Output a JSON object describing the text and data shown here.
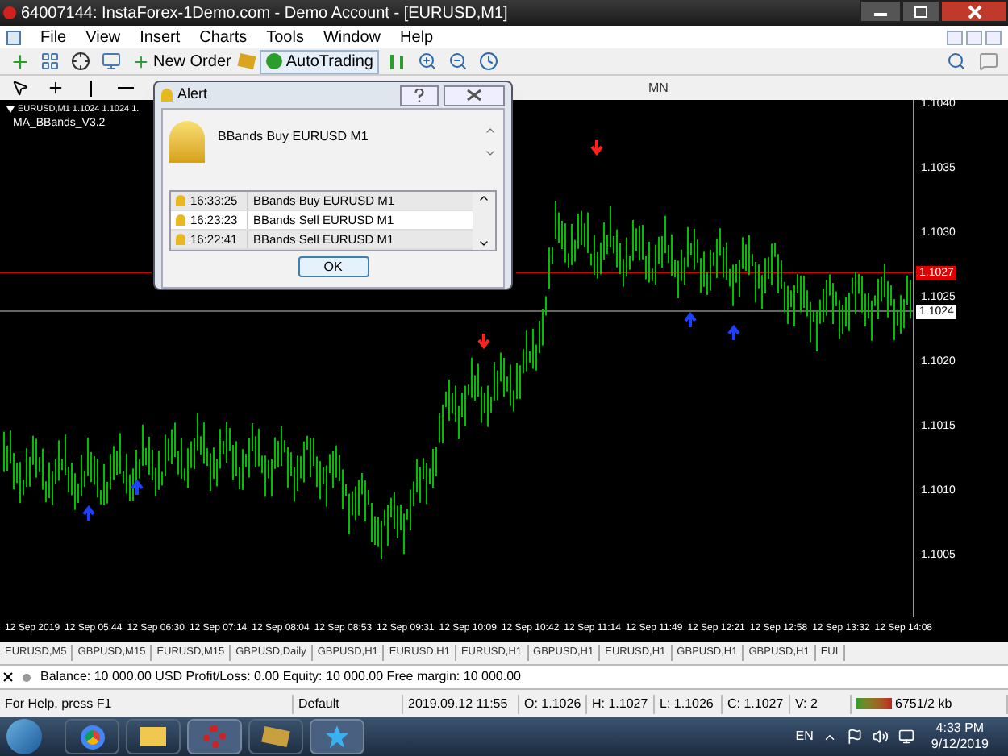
{
  "window": {
    "title": "64007144: InstaForex-1Demo.com - Demo Account - [EURUSD,M1]"
  },
  "menu": [
    "File",
    "View",
    "Insert",
    "Charts",
    "Tools",
    "Window",
    "Help"
  ],
  "toolbar": {
    "new_order": "New Order",
    "auto_trading": "AutoTrading",
    "period": "MN"
  },
  "chart": {
    "info_line": "EURUSD,M1  1.1024 1.1024 1.",
    "indicator": "MA_BBands_V3.2",
    "price_ticks": [
      "1.1040",
      "1.1035",
      "1.1030",
      "1.1025",
      "1.1020",
      "1.1015",
      "1.1010",
      "1.1005"
    ],
    "bid_marker": "1.1027",
    "ask_marker": "1.1024",
    "time_labels": [
      "12 Sep 2019",
      "12 Sep 05:44",
      "12 Sep 06:30",
      "12 Sep 07:14",
      "12 Sep 08:04",
      "12 Sep 08:53",
      "12 Sep 09:31",
      "12 Sep 10:09",
      "12 Sep 10:42",
      "12 Sep 11:14",
      "12 Sep 11:49",
      "12 Sep 12:21",
      "12 Sep 12:58",
      "12 Sep 13:32",
      "12 Sep 14:08"
    ]
  },
  "alert": {
    "title": "Alert",
    "message": "BBands Buy EURUSD M1",
    "rows": [
      {
        "time": "16:33:25",
        "text": "BBands Buy EURUSD M1"
      },
      {
        "time": "16:23:23",
        "text": "BBands Sell EURUSD M1"
      },
      {
        "time": "16:22:41",
        "text": "BBands Sell EURUSD M1"
      }
    ],
    "ok": "OK"
  },
  "chart_tabs": [
    {
      "label": "EURUSD,M5",
      "selected": false
    },
    {
      "label": "GBPUSD,M15",
      "selected": false
    },
    {
      "label": "EURUSD,M15",
      "selected": false
    },
    {
      "label": "GBPUSD,Daily",
      "selected": false
    },
    {
      "label": "GBPUSD,H1",
      "selected": false
    },
    {
      "label": "EURUSD,H1",
      "selected": false
    },
    {
      "label": "EURUSD,H1",
      "selected": false
    },
    {
      "label": "GBPUSD,H1",
      "selected": false
    },
    {
      "label": "EURUSD,H1",
      "selected": false
    },
    {
      "label": "GBPUSD,H1",
      "selected": false
    },
    {
      "label": "GBPUSD,H1",
      "selected": false
    },
    {
      "label": "EUI",
      "selected": false
    }
  ],
  "terminal": {
    "line": "Balance: 10 000.00 USD  Profit/Loss: 0.00  Equity: 10 000.00  Free margin: 10 000.00"
  },
  "status_bar": [
    "For Help, press F1",
    "Default",
    "2019.09.12 11:55",
    "O: 1.1026",
    "H: 1.1027",
    "L: 1.1026",
    "C: 1.1027",
    "V: 2",
    "6751/2 kb"
  ],
  "taskbar": {
    "language": "EN",
    "time": "4:33 PM",
    "date": "9/12/2019"
  }
}
